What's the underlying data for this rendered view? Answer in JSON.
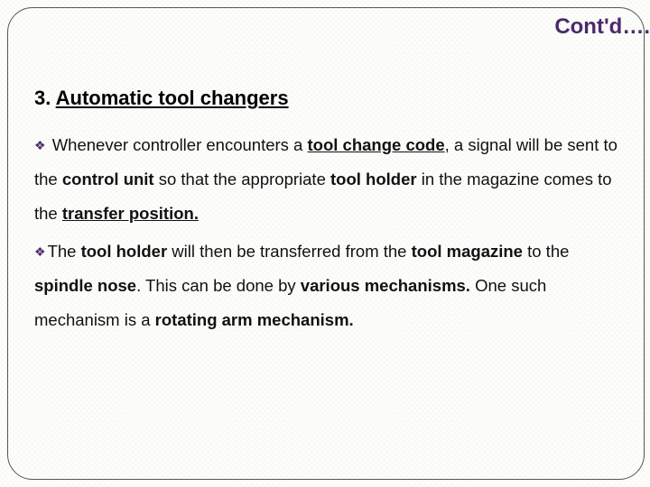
{
  "header": {
    "title": "Cont'd…."
  },
  "section": {
    "number": "3.",
    "title": "Automatic tool changers"
  },
  "bullet_glyph": "❖",
  "paragraphs": {
    "p1": {
      "t1": " Whenever controller encounters a ",
      "code": "tool change code",
      "t2": ", a signal will be sent to the ",
      "cu": "control unit",
      "t3": " so that the appropriate ",
      "th": "tool holder",
      "t4": " in the magazine comes to the ",
      "tp": "transfer position.",
      "t5": ""
    },
    "p2": {
      "t1": "The ",
      "th": "tool holder",
      "t2": " will then be transferred from the ",
      "tm": "tool magazine",
      "t3": " to the ",
      "sn": "spindle nose",
      "t4": ". This can be done by ",
      "vm": "various mechanisms.",
      "t5": " One such mechanism is a ",
      "ram": "rotating arm mechanism.",
      "t6": ""
    }
  }
}
